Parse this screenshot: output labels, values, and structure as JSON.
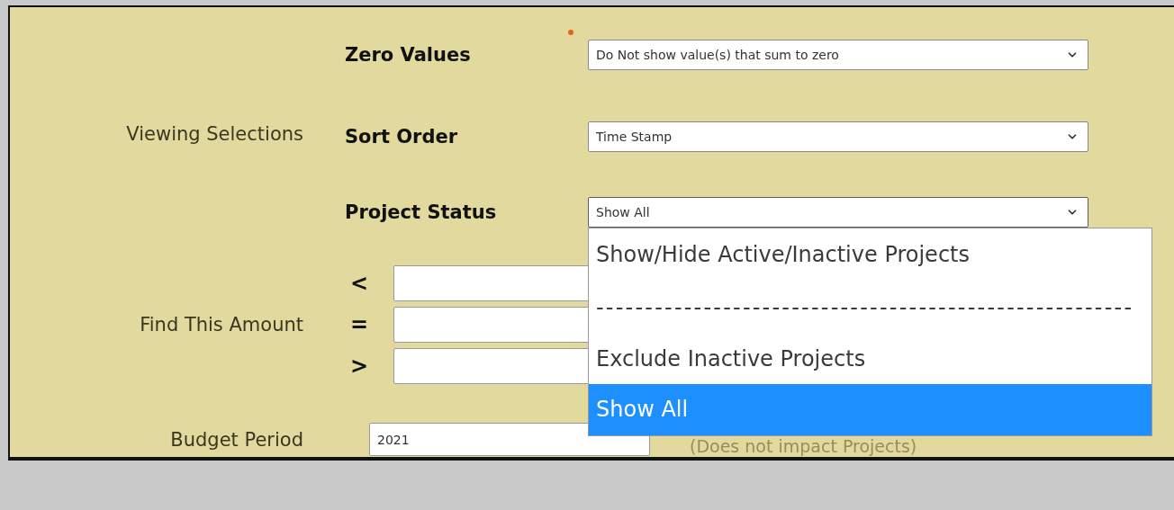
{
  "viewing_selections": {
    "label": "Viewing Selections",
    "fields": [
      {
        "label": "Zero Values",
        "value": "Do Not show value(s) that sum to zero",
        "required": true,
        "expanded": false
      },
      {
        "label": "Sort Order",
        "value": "Time Stamp",
        "required": false,
        "expanded": false
      },
      {
        "label": "Project Status",
        "value": "Show All",
        "required": false,
        "expanded": true,
        "options": [
          {
            "label": "Show/Hide Active/Inactive Projects",
            "selected": false
          },
          {
            "label": "-------------------------------------------------------",
            "selected": false
          },
          {
            "label": "Exclude Inactive Projects",
            "selected": false
          },
          {
            "label": "Show All",
            "selected": true
          }
        ]
      }
    ]
  },
  "find_amount": {
    "label": "Find This Amount",
    "fields": [
      {
        "operator": "<"
      },
      {
        "operator": "="
      },
      {
        "operator": ">"
      }
    ]
  },
  "budget_period": {
    "label": "Budget Period",
    "value": "2021",
    "note": "(Does not impact Projects)"
  }
}
